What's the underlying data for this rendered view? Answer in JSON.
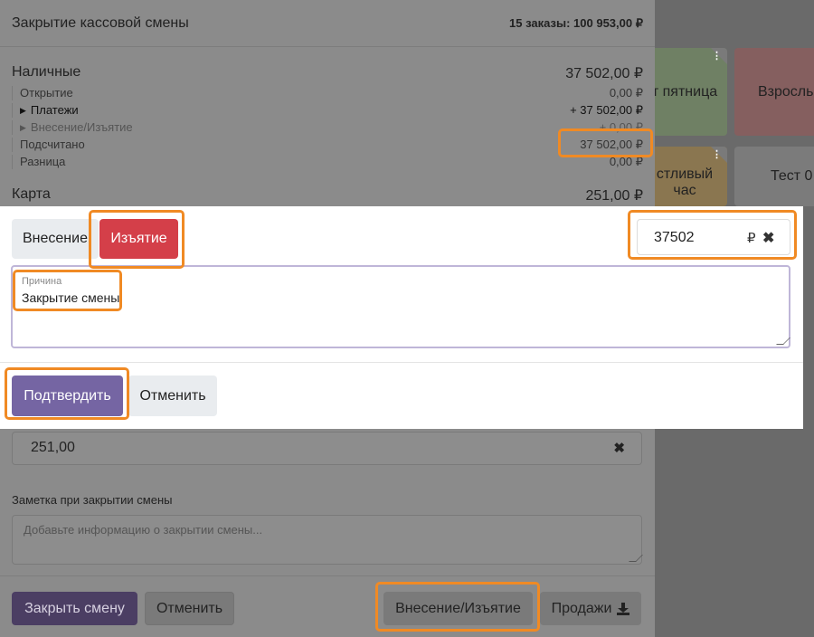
{
  "background_tiles": [
    {
      "label": "т пятница",
      "color": "#6f8064"
    },
    {
      "label": "Взросль",
      "color": "#855f5f"
    },
    {
      "label": "стливый\nчас",
      "color": "#8a7650"
    },
    {
      "label": "Тест 0",
      "color": "#7b7b7b"
    }
  ],
  "panel": {
    "title": "Закрытие кассовой смены",
    "summary": "15 заказы: 100 953,00 ₽",
    "cash": {
      "label": "Наличные",
      "total": "37 502,00 ₽",
      "opening_label": "Открытие",
      "opening_value": "0,00 ₽",
      "payments_label": "Платежи",
      "payments_value": "+ 37 502,00 ₽",
      "cash_moves_label": "Внесение/Изъятие",
      "cash_moves_value": "+ 0,00 ₽",
      "counted_label": "Подсчитано",
      "counted_value": "37 502,00 ₽",
      "difference_label": "Разница",
      "difference_value": "0,00 ₽"
    },
    "card": {
      "label": "Карта",
      "total": "251,00 ₽",
      "input_value": "251,00"
    },
    "note": {
      "label": "Заметка при закрытии смены",
      "placeholder": "Добавьте информацию о закрытии смены..."
    },
    "buttons": {
      "close_shift": "Закрыть смену",
      "cancel": "Отменить",
      "cash_in_out": "Внесение/Изъятие",
      "sales": "Продажи"
    }
  },
  "dialog": {
    "tab_in": "Внесение",
    "tab_out": "Изъятие",
    "amount": "37502",
    "currency": "₽",
    "reason_label": "Причина",
    "reason_value": "Закрытие смены",
    "confirm": "Подтвердить",
    "cancel": "Отменить"
  },
  "colors": {
    "accent": "#7565a3",
    "danger": "#d43f49",
    "highlight": "#f08a24"
  }
}
